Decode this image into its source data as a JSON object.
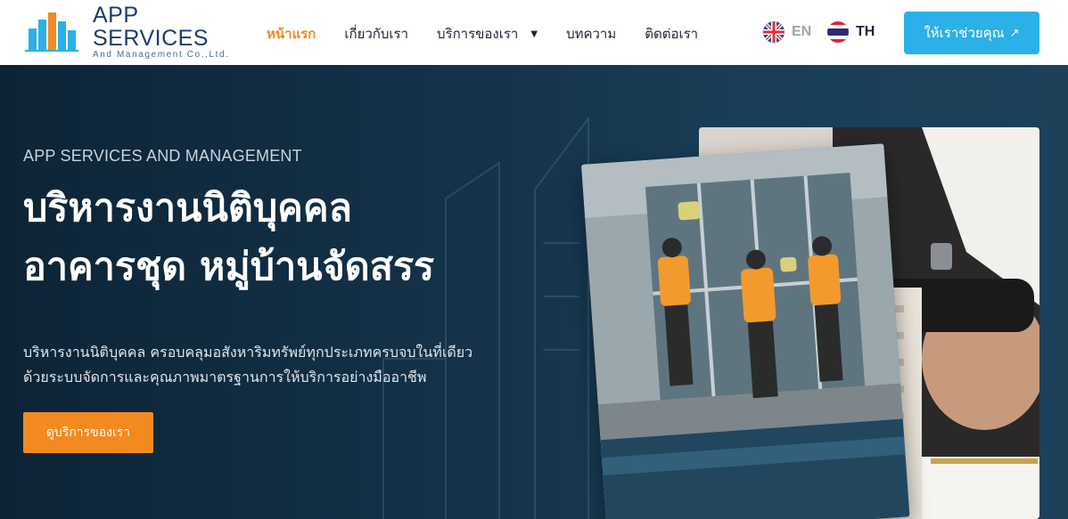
{
  "brand": {
    "title": "APP SERVICES",
    "subtitle": "And Management Co.,Ltd.",
    "colors": {
      "navy": "#1f3a6b",
      "sky": "#2bb0e8",
      "orange": "#f38a1f"
    }
  },
  "nav": {
    "items": [
      {
        "label": "หน้าแรก",
        "active": true
      },
      {
        "label": "เกี่ยวกับเรา",
        "active": false
      },
      {
        "label": "บริการของเรา",
        "active": false,
        "dropdown": true
      },
      {
        "label": "บทความ",
        "active": false
      },
      {
        "label": "ติดต่อเรา",
        "active": false
      }
    ],
    "dropdown_icon": "caret-down-icon"
  },
  "languages": {
    "en": {
      "label": "EN",
      "icon": "uk-flag-icon"
    },
    "th": {
      "label": "TH",
      "icon": "thai-flag-icon",
      "selected": true
    }
  },
  "header_cta": {
    "label": "ให้เราช่วยคุณ",
    "icon": "external-arrow-icon"
  },
  "hero": {
    "kicker": "APP SERVICES AND MANAGEMENT",
    "headline_line1": "บริหารงานนิติบุคคล",
    "headline_line2": "อาคารชุด หมู่บ้านจัดสรร",
    "desc_line1": "บริหารงานนิติบุคคล ครอบคลุมอสังหาริมทรัพย์ทุกประเภทครบจบในที่เดียว",
    "desc_line2": "ด้วยระบบจัดการและคุณภาพมาตรฐานการให้บริการอย่างมืออาชีพ",
    "button_label": "ดูบริการของเรา"
  }
}
